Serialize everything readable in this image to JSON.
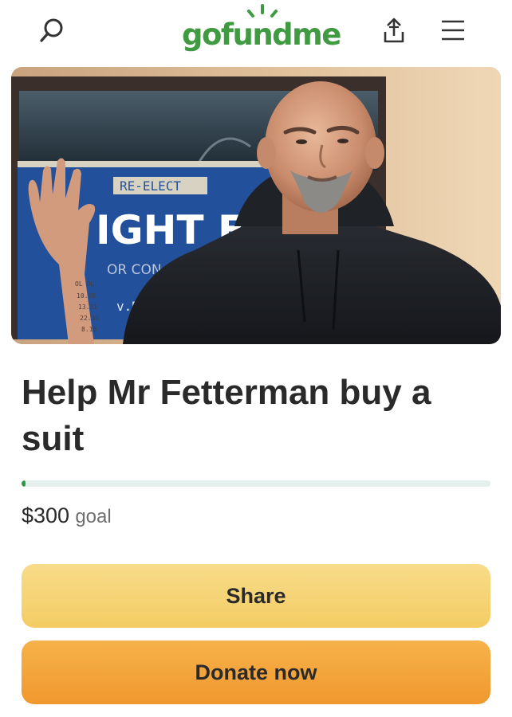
{
  "header": {
    "logo_text": "gofundme",
    "brand_color": "#3f9a41",
    "icons": [
      "search-icon",
      "share-upload-icon",
      "hamburger-menu-icon"
    ]
  },
  "hero": {
    "sign_lines": [
      "RE-ELECT",
      "IGHT EV",
      "OR CON",
      "v.Dwi"
    ]
  },
  "campaign": {
    "title": "Help Mr Fetterman buy a suit",
    "goal_amount": "$300",
    "goal_label": "goal",
    "progress_fraction": 0.0
  },
  "actions": {
    "share_label": "Share",
    "donate_label": "Donate now",
    "share_color": "#f6d372",
    "donate_color": "#f3a43a"
  }
}
